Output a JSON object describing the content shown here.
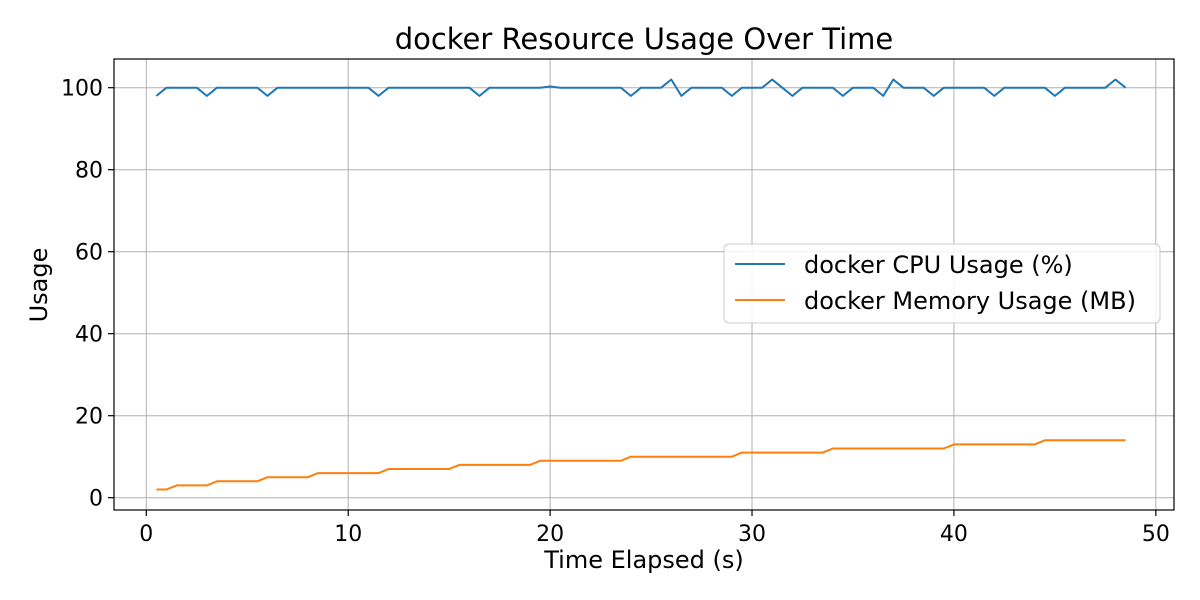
{
  "chart_data": {
    "type": "line",
    "title": "docker Resource Usage Over Time",
    "xlabel": "Time Elapsed (s)",
    "ylabel": "Usage",
    "xlim": [
      -1.6,
      50.9
    ],
    "ylim": [
      -3,
      107
    ],
    "xticks": [
      0,
      10,
      20,
      30,
      40,
      50
    ],
    "yticks": [
      0,
      20,
      40,
      60,
      80,
      100
    ],
    "xtick_labels": [
      "0",
      "10",
      "20",
      "30",
      "40",
      "50"
    ],
    "ytick_labels": [
      "0",
      "20",
      "40",
      "60",
      "80",
      "100"
    ],
    "grid": true,
    "legend_position": "center-right",
    "series": [
      {
        "name": "docker CPU Usage (%)",
        "color": "#1f77b4",
        "x": [
          0.5,
          1.0,
          1.5,
          2.0,
          2.5,
          3.0,
          3.5,
          4.0,
          4.5,
          5.0,
          5.5,
          6.0,
          6.5,
          7.0,
          7.5,
          8.0,
          8.5,
          9.0,
          9.5,
          10.0,
          10.5,
          11.0,
          11.5,
          12.0,
          12.5,
          13.0,
          13.5,
          14.0,
          14.5,
          15.0,
          15.5,
          16.0,
          16.5,
          17.0,
          17.5,
          18.0,
          18.5,
          19.0,
          19.5,
          20.0,
          20.5,
          21.0,
          21.5,
          22.0,
          22.5,
          23.0,
          23.5,
          24.0,
          24.5,
          25.0,
          25.5,
          26.0,
          26.5,
          27.0,
          27.5,
          28.0,
          28.5,
          29.0,
          29.5,
          30.0,
          30.5,
          31.0,
          31.5,
          32.0,
          32.5,
          33.0,
          33.5,
          34.0,
          34.5,
          35.0,
          35.5,
          36.0,
          36.5,
          37.0,
          37.5,
          38.0,
          38.5,
          39.0,
          39.5,
          40.0,
          40.5,
          41.0,
          41.5,
          42.0,
          42.5,
          43.0,
          43.5,
          44.0,
          44.5,
          45.0,
          45.5,
          46.0,
          46.5,
          47.0,
          47.5,
          48.0,
          48.5
        ],
        "values": [
          98,
          100,
          100,
          100,
          100,
          98,
          100,
          100,
          100,
          100,
          100,
          98,
          100,
          100,
          100,
          100,
          100,
          100,
          100,
          100,
          100,
          100,
          98,
          100,
          100,
          100,
          100,
          100,
          100,
          100,
          100,
          100,
          98,
          100,
          100,
          100,
          100,
          100,
          100,
          100.3,
          100,
          100,
          100,
          100,
          100,
          100,
          100,
          98,
          100,
          100,
          100,
          102,
          98,
          100,
          100,
          100,
          100,
          98,
          100,
          100,
          100,
          102,
          100,
          98,
          100,
          100,
          100,
          100,
          98,
          100,
          100,
          100,
          98,
          102,
          100,
          100,
          100,
          98,
          100,
          100,
          100,
          100,
          100,
          98,
          100,
          100,
          100,
          100,
          100,
          98,
          100,
          100,
          100,
          100,
          100,
          102,
          100
        ]
      },
      {
        "name": "docker Memory Usage (MB)",
        "color": "#ff7f0e",
        "x": [
          0.5,
          1.0,
          1.5,
          2.0,
          2.5,
          3.0,
          3.5,
          4.0,
          4.5,
          5.0,
          5.5,
          6.0,
          6.5,
          7.0,
          7.5,
          8.0,
          8.5,
          9.0,
          9.5,
          10.0,
          10.5,
          11.0,
          11.5,
          12.0,
          12.5,
          13.0,
          13.5,
          14.0,
          14.5,
          15.0,
          15.5,
          16.0,
          16.5,
          17.0,
          17.5,
          18.0,
          18.5,
          19.0,
          19.5,
          20.0,
          20.5,
          21.0,
          21.5,
          22.0,
          22.5,
          23.0,
          23.5,
          24.0,
          24.5,
          25.0,
          25.5,
          26.0,
          26.5,
          27.0,
          27.5,
          28.0,
          28.5,
          29.0,
          29.5,
          30.0,
          30.5,
          31.0,
          31.5,
          32.0,
          32.5,
          33.0,
          33.5,
          34.0,
          34.5,
          35.0,
          35.5,
          36.0,
          36.5,
          37.0,
          37.5,
          38.0,
          38.5,
          39.0,
          39.5,
          40.0,
          40.5,
          41.0,
          41.5,
          42.0,
          42.5,
          43.0,
          43.5,
          44.0,
          44.5,
          45.0,
          45.5,
          46.0,
          46.5,
          47.0,
          47.5,
          48.0,
          48.5
        ],
        "values": [
          2,
          2,
          3,
          3,
          3,
          3,
          4,
          4,
          4,
          4,
          4,
          5,
          5,
          5,
          5,
          5,
          6,
          6,
          6,
          6,
          6,
          6,
          6,
          7,
          7,
          7,
          7,
          7,
          7,
          7,
          8,
          8,
          8,
          8,
          8,
          8,
          8,
          8,
          9,
          9,
          9,
          9,
          9,
          9,
          9,
          9,
          9,
          10,
          10,
          10,
          10,
          10,
          10,
          10,
          10,
          10,
          10,
          10,
          11,
          11,
          11,
          11,
          11,
          11,
          11,
          11,
          11,
          12,
          12,
          12,
          12,
          12,
          12,
          12,
          12,
          12,
          12,
          12,
          12,
          13,
          13,
          13,
          13,
          13,
          13,
          13,
          13,
          13,
          14,
          14,
          14,
          14,
          14,
          14,
          14,
          14,
          14
        ]
      }
    ]
  }
}
